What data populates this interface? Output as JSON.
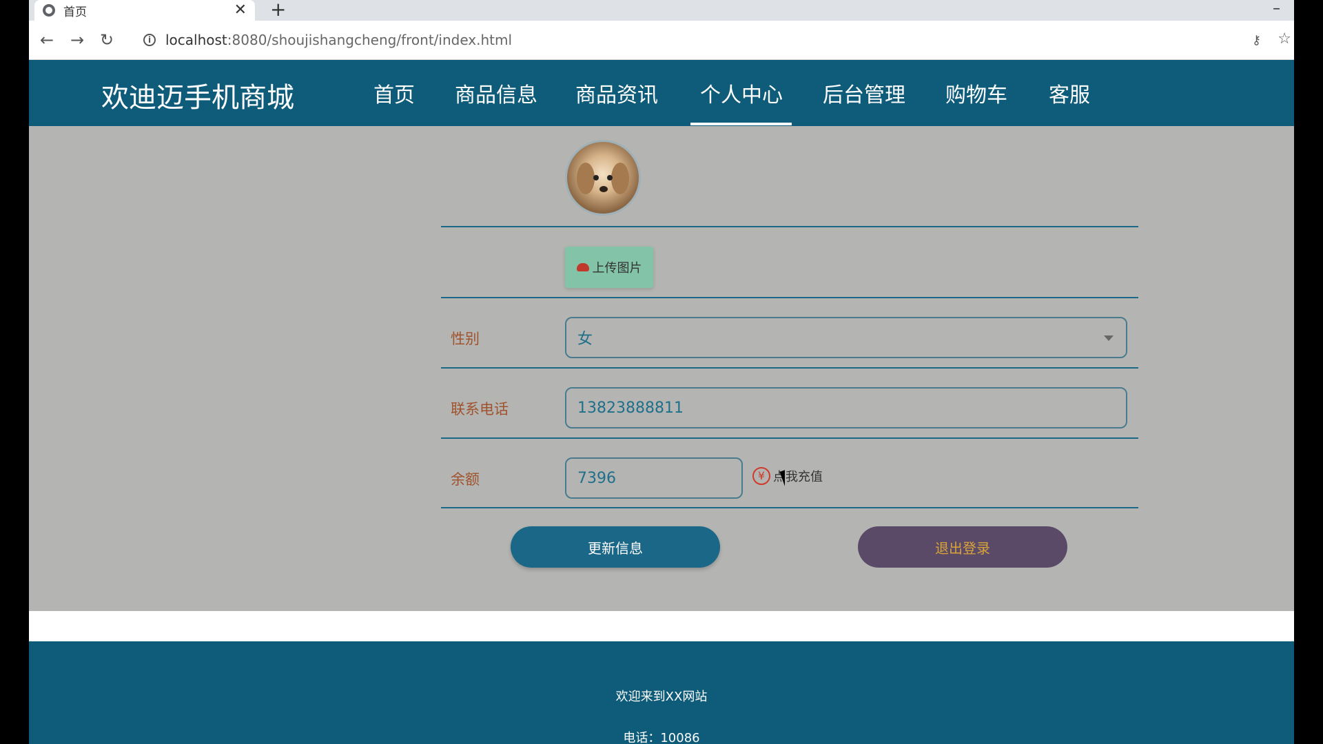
{
  "browser": {
    "tab_title": "首页",
    "close_glyph": "✕",
    "new_tab_glyph": "+",
    "minimize_glyph": "–",
    "url_host": "localhost",
    "url_rest": ":8080/shoujishangcheng/front/index.html",
    "back_glyph": "←",
    "forward_glyph": "→",
    "reload_glyph": "↻",
    "info_glyph": "i",
    "key_glyph": "⚷",
    "star_glyph": "☆"
  },
  "header": {
    "brand": "欢迪迈手机商城",
    "nav": [
      {
        "label": "首页"
      },
      {
        "label": "商品信息"
      },
      {
        "label": "商品资讯"
      },
      {
        "label": "个人中心",
        "active": true
      },
      {
        "label": "后台管理"
      },
      {
        "label": "购物车"
      },
      {
        "label": "客服"
      }
    ]
  },
  "profile": {
    "upload_label": "上传图片",
    "gender_label": "性别",
    "gender_value": "女",
    "phone_label": "联系电话",
    "phone_value": "13823888811",
    "balance_label": "余额",
    "balance_value": "7396",
    "recharge_label": "点我充值",
    "yen_glyph": "¥",
    "update_button": "更新信息",
    "logout_button": "退出登录"
  },
  "footer": {
    "welcome": "欢迎来到XX网站",
    "contact": "电话：10086"
  },
  "colors": {
    "header_bg": "#0f5c7a",
    "content_bg": "#b4b5b2",
    "update_btn": "#1a6787",
    "logout_btn": "#5a4a67",
    "upload_btn": "#83c3a8"
  }
}
